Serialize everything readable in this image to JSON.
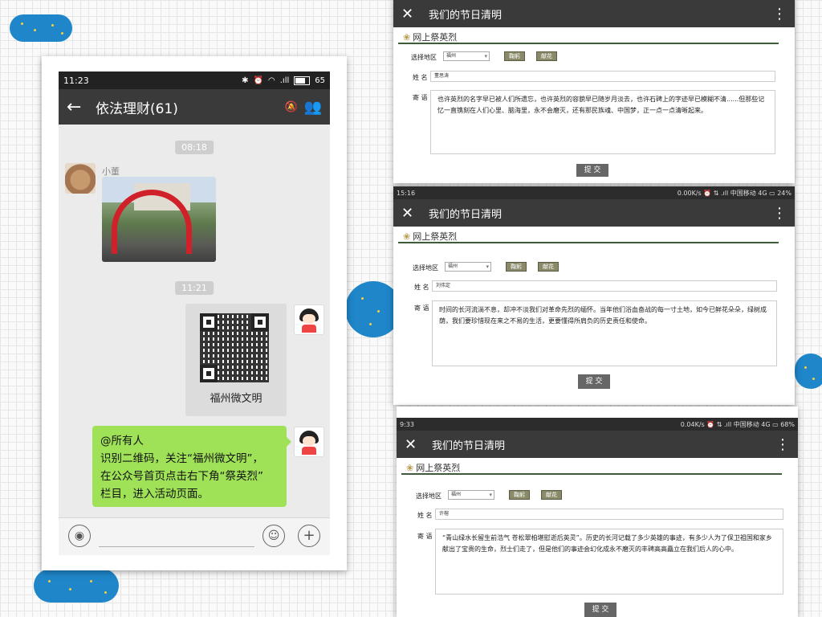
{
  "phone": {
    "status_time": "11:23",
    "battery": "65",
    "chat_title": "依法理财(61)",
    "timestamps": [
      "08:18",
      "11:21"
    ],
    "sender_name": "小董",
    "qr_label": "福州微文明",
    "message_lines": [
      "@所有人",
      "识别二维码，关注“福州微文明”，",
      "在公众号首页点击右下角“祭英烈”",
      "栏目，进入活动页面。"
    ]
  },
  "forms": [
    {
      "status_left": "",
      "status_right": "",
      "header_title": "我们的节日清明",
      "section_title": "网上祭英烈",
      "region_label": "选择地区",
      "region_value": "福州",
      "tag1": "鞠躬",
      "tag2": "献花",
      "name_label": "姓 名",
      "name_value": "董思涛",
      "message_label": "寄 语",
      "message_text": "也许英烈的名字早已被人们所遗忘，也许英烈的容貌早已随岁月淡去，也许石碑上的字迹早已模糊不清......但那些记忆一直镌刻在人们心里、脑海里，永不会磨灭，还有那民族魂、中国梦，正一点一点清晰起来。",
      "submit": "提 交"
    },
    {
      "status_left": "15:16",
      "status_right": "0.00K/s ⏰ ⇅ .ıll 中国移动 4G ▭ 24%",
      "header_title": "我们的节日清明",
      "section_title": "网上祭英烈",
      "region_label": "选择地区",
      "region_value": "福州",
      "tag1": "鞠躬",
      "tag2": "献花",
      "name_label": "姓 名",
      "name_value": "刘伟定",
      "message_label": "寄 语",
      "message_text": "时间的长河流淌不息，却冲不淡我们对革命先烈的缅怀。当年他们浴血奋战的每一寸土地，如今已鲜花朵朵，绿树成荫，我们要珍惜现在来之不易的生活，更要懂得所肩负的历史责任和使命。",
      "submit": "提 交"
    },
    {
      "status_left": "9:33",
      "status_right": "0.04K/s ⏰ ⇅ .ıll 中国移动 4G ▭ 68%",
      "header_title": "我们的节日清明",
      "section_title": "网上祭英烈",
      "region_label": "选择地区",
      "region_value": "福州",
      "tag1": "鞠躬",
      "tag2": "献花",
      "name_label": "姓 名",
      "name_value": "许榕",
      "message_label": "寄 语",
      "message_text": "“青山绿水长留生前浩气 苍松翠柏堪慰逝后英灵”。历史的长河记载了多少英雄的事迹，有多少人为了保卫祖国和家乡献出了宝贵的生命，烈士们走了，但是他们的事迹会幻化成永不磨灭的丰碑高高矗立在我们后人的心中。",
      "submit": "提 交"
    }
  ]
}
